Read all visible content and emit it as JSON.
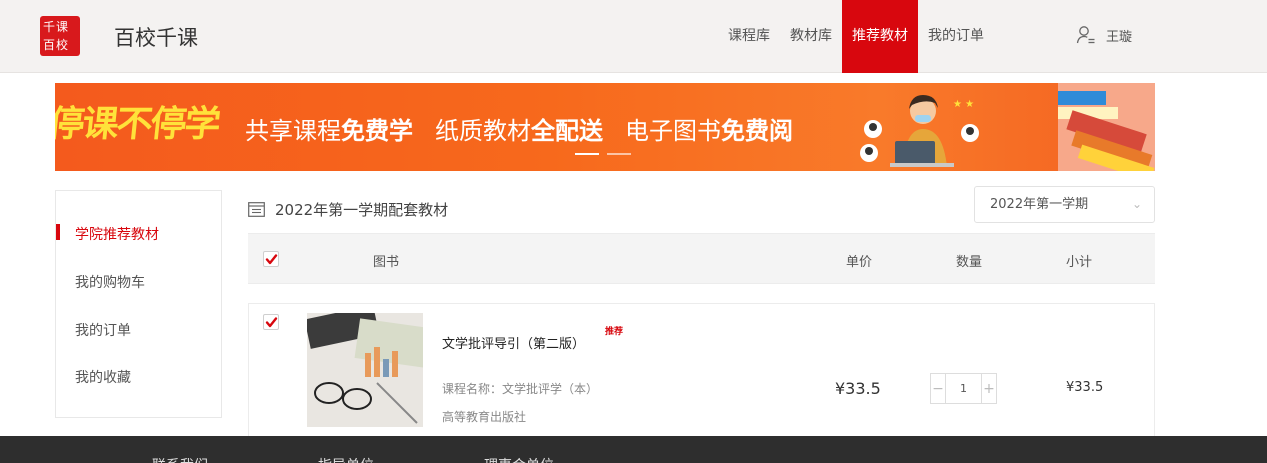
{
  "header": {
    "logo_text": "千课百校",
    "brand": "百校千课",
    "nav": [
      "课程库",
      "教材库",
      "推荐教材",
      "我的订单"
    ],
    "active_nav": "推荐教材",
    "user_name": "王璇"
  },
  "banner": {
    "left_text": "停课不停学",
    "slogan_1a": "共享课程",
    "slogan_1b": "免费学",
    "slogan_2a": "纸质教材",
    "slogan_2b": "全配送",
    "slogan_3a": "电子图书",
    "slogan_3b": "免费阅"
  },
  "sidebar": {
    "items": [
      "学院推荐教材",
      "我的购物车",
      "我的订单",
      "我的收藏"
    ],
    "active": "学院推荐教材"
  },
  "main": {
    "section_title": "2022年第一学期配套教材",
    "term_select": "2022年第一学期",
    "table_headers": {
      "book": "图书",
      "price": "单价",
      "qty": "数量",
      "subtotal": "小计"
    },
    "rows": [
      {
        "title": "文学批评导引（第二版）",
        "tag": "推荐",
        "course": "课程名称：文学批评学（本）",
        "publisher": "高等教育出版社",
        "price": "¥33.5",
        "qty": "1",
        "subtotal": "¥33.5"
      }
    ]
  },
  "footer": {
    "links": [
      "联系我们",
      "指导单位",
      "理事会单位"
    ]
  },
  "colors": {
    "accent": "#d8070e",
    "banner": "#f7691c",
    "footer": "#2e2e2e"
  }
}
